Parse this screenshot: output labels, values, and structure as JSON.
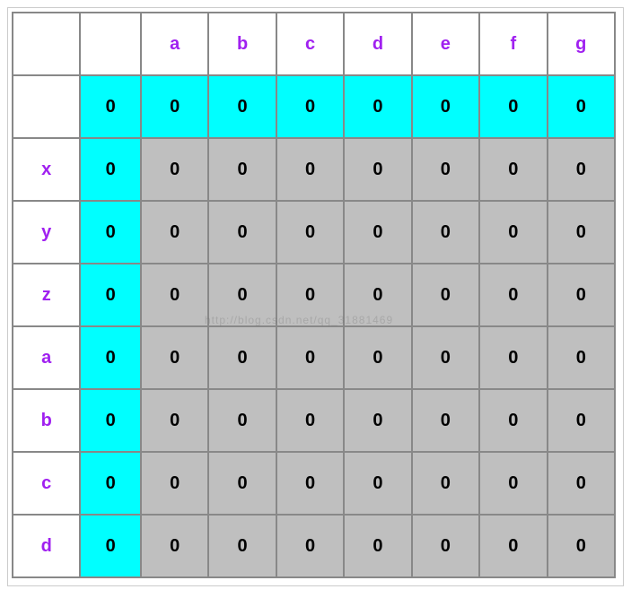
{
  "col_headers": [
    "a",
    "b",
    "c",
    "d",
    "e",
    "f",
    "g"
  ],
  "row_headers": [
    "x",
    "y",
    "z",
    "a",
    "b",
    "c",
    "d"
  ],
  "zero_row": [
    "0",
    "0",
    "0",
    "0",
    "0",
    "0",
    "0",
    "0"
  ],
  "grid": [
    [
      "0",
      "0",
      "0",
      "0",
      "0",
      "0",
      "0",
      "0"
    ],
    [
      "0",
      "0",
      "0",
      "0",
      "0",
      "0",
      "0",
      "0"
    ],
    [
      "0",
      "0",
      "0",
      "0",
      "0",
      "0",
      "0",
      "0"
    ],
    [
      "0",
      "0",
      "0",
      "0",
      "0",
      "0",
      "0",
      "0"
    ],
    [
      "0",
      "0",
      "0",
      "0",
      "0",
      "0",
      "0",
      "0"
    ],
    [
      "0",
      "0",
      "0",
      "0",
      "0",
      "0",
      "0",
      "0"
    ],
    [
      "0",
      "0",
      "0",
      "0",
      "0",
      "0",
      "0",
      "0"
    ]
  ],
  "watermark": "http://blog.csdn.net/qq_31881469"
}
